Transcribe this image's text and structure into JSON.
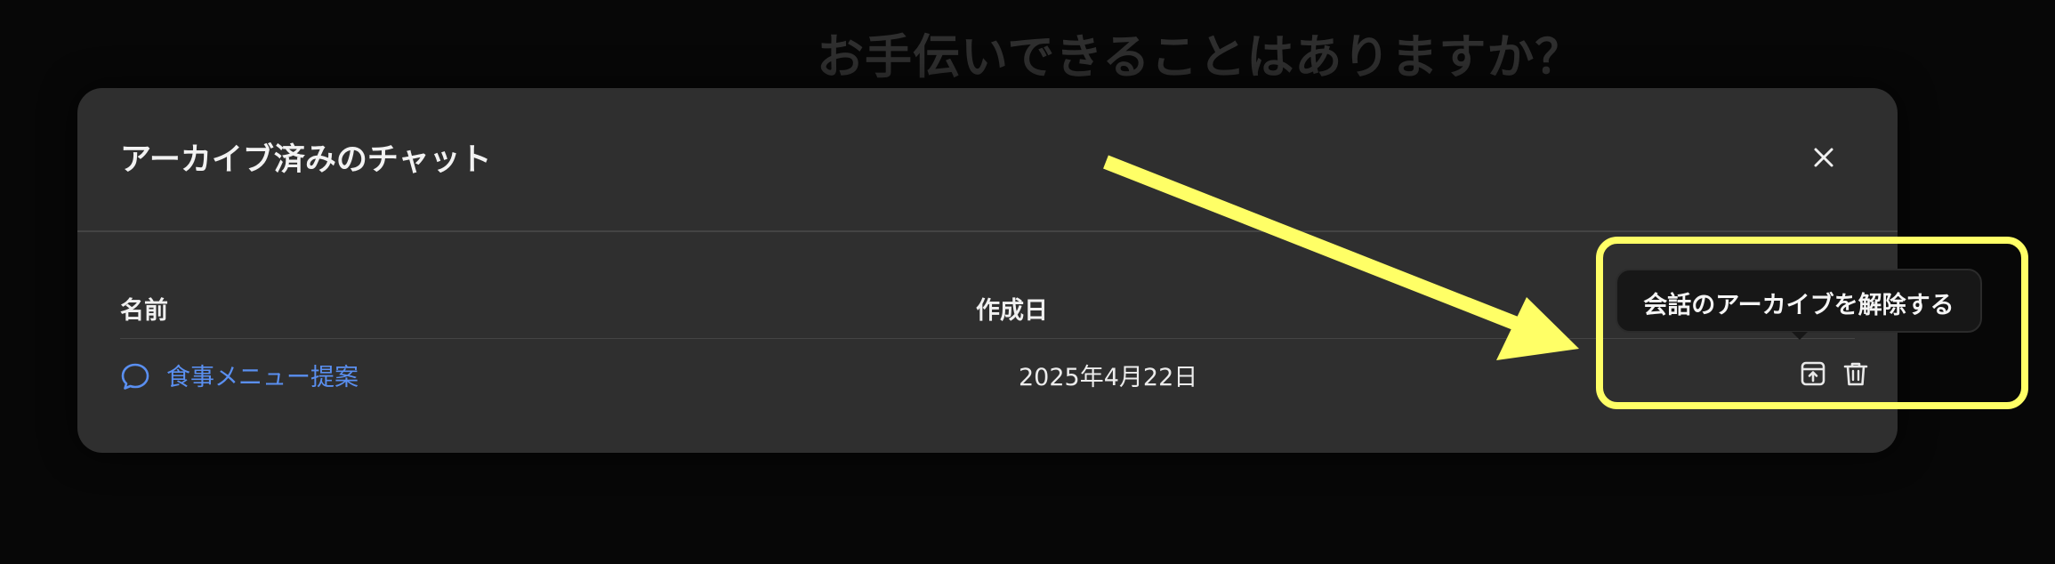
{
  "background": {
    "heading": "お手伝いできることはありますか？"
  },
  "modal": {
    "title": "アーカイブ済みのチャット",
    "close_icon": "close-icon"
  },
  "table": {
    "columns": [
      "名前",
      "作成日"
    ],
    "rows": [
      {
        "name": "食事メニュー提案",
        "created": "2025年4月22日",
        "icon": "chat-bubble-icon",
        "actions": [
          "unarchive-icon",
          "trash-icon"
        ]
      }
    ]
  },
  "tooltip": {
    "text": "会話のアーカイブを解除する"
  },
  "annotation": {
    "color": "#ffff66"
  },
  "colors": {
    "link": "#5a8ff0",
    "modal_bg": "#2f2f2f",
    "page_bg": "#070707"
  }
}
